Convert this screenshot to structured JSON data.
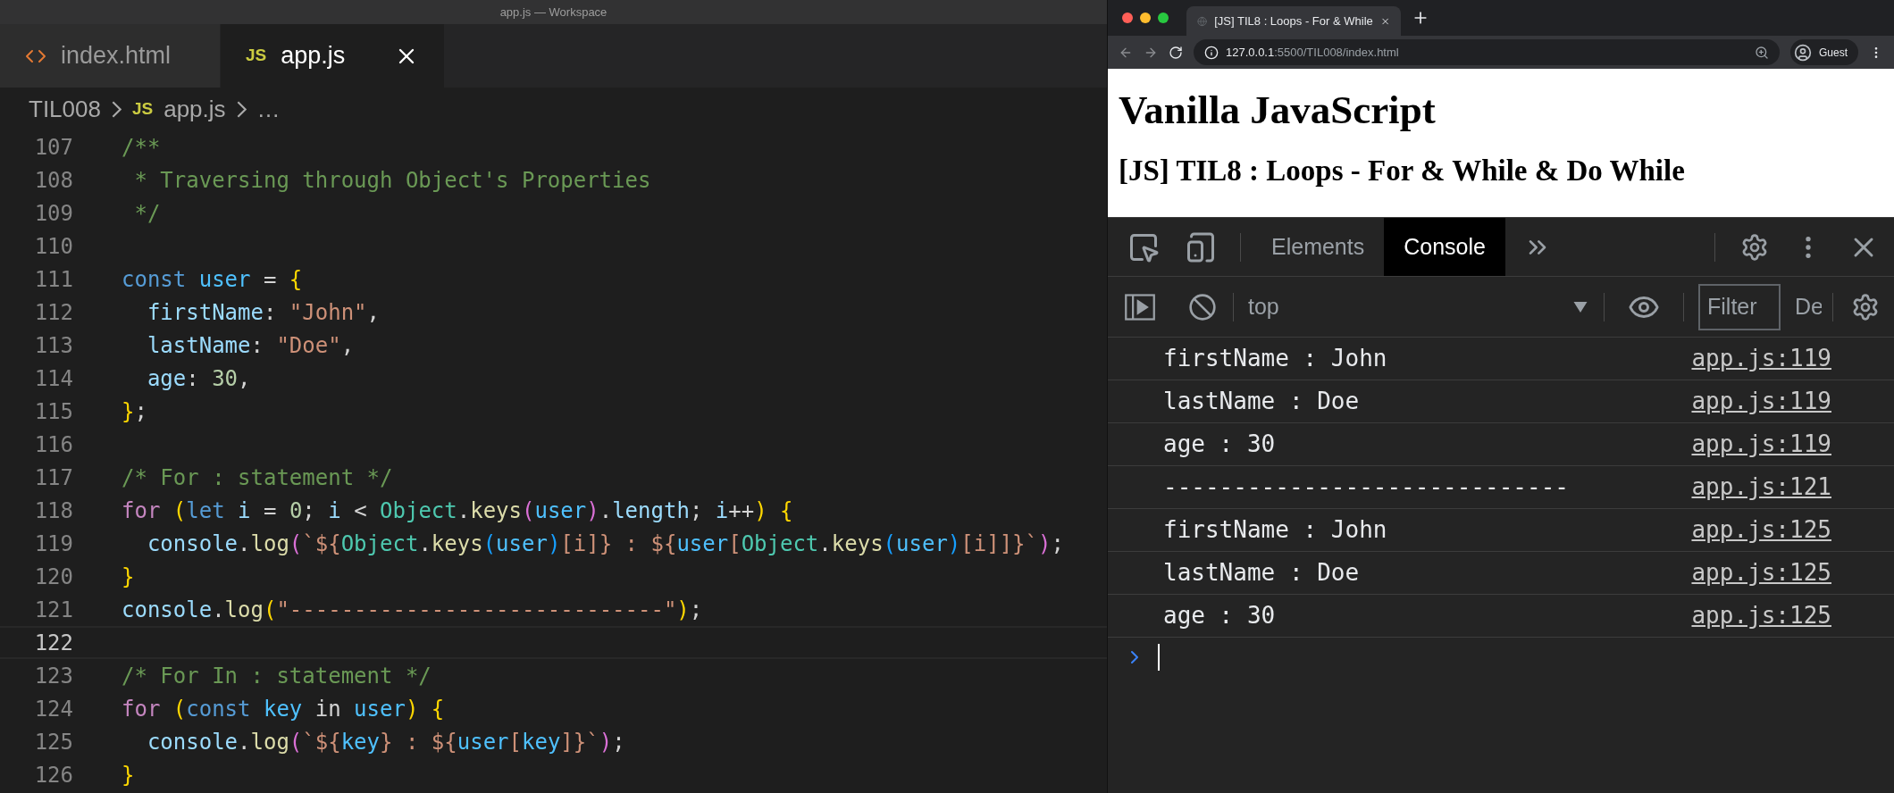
{
  "window": {
    "title": "app.js — Workspace"
  },
  "editor": {
    "tabs": [
      {
        "kind": "html",
        "label": "index.html",
        "selected": false
      },
      {
        "kind": "js",
        "badge": "JS",
        "label": "app.js",
        "selected": true
      }
    ],
    "breadcrumb": [
      {
        "kind": "folder",
        "label": "TIL008"
      },
      {
        "kind": "js",
        "badge": "JS",
        "label": "app.js"
      },
      {
        "kind": "more",
        "label": "…"
      }
    ],
    "lines": [
      {
        "number": "107",
        "current": false,
        "tokens": [
          {
            "kind": "comment",
            "text": "/**"
          }
        ]
      },
      {
        "number": "108",
        "current": false,
        "tokens": [
          {
            "kind": "comment",
            "text": " * Traversing through Object's Properties"
          }
        ]
      },
      {
        "number": "109",
        "current": false,
        "tokens": [
          {
            "kind": "comment",
            "text": " */"
          }
        ]
      },
      {
        "number": "110",
        "current": false
      },
      {
        "number": "111",
        "current": false,
        "tokens": [
          {
            "kind": "storage",
            "text": "const"
          },
          {
            "kind": "constant",
            "text": " user"
          },
          {
            "kind": "plain",
            "text": " = "
          },
          {
            "kind": "bracket1",
            "text": "{"
          }
        ]
      },
      {
        "number": "112",
        "current": false,
        "tokens": [
          {
            "kind": "property",
            "text": "  firstName"
          },
          {
            "kind": "plain",
            "text": ": "
          },
          {
            "kind": "string",
            "text": "\"John\""
          },
          {
            "kind": "plain",
            "text": ","
          }
        ]
      },
      {
        "number": "113",
        "current": false,
        "tokens": [
          {
            "kind": "property",
            "text": "  lastName"
          },
          {
            "kind": "plain",
            "text": ": "
          },
          {
            "kind": "string",
            "text": "\"Doe\""
          },
          {
            "kind": "plain",
            "text": ","
          }
        ]
      },
      {
        "number": "114",
        "current": false,
        "tokens": [
          {
            "kind": "property",
            "text": "  age"
          },
          {
            "kind": "plain",
            "text": ": "
          },
          {
            "kind": "number",
            "text": "30"
          },
          {
            "kind": "plain",
            "text": ","
          }
        ]
      },
      {
        "number": "115",
        "current": false,
        "tokens": [
          {
            "kind": "bracket1",
            "text": "}"
          },
          {
            "kind": "plain",
            "text": ";"
          }
        ]
      },
      {
        "number": "116",
        "current": false
      },
      {
        "number": "117",
        "current": false,
        "tokens": [
          {
            "kind": "comment",
            "text": "/* For : statement */"
          }
        ]
      },
      {
        "number": "118",
        "current": false,
        "tokens": [
          {
            "kind": "control",
            "text": "for"
          },
          {
            "kind": "bracket1",
            "text": " ("
          },
          {
            "kind": "storage",
            "text": "let"
          },
          {
            "kind": "property",
            "text": " i"
          },
          {
            "kind": "plain",
            "text": " = "
          },
          {
            "kind": "number",
            "text": "0"
          },
          {
            "kind": "plain",
            "text": "; "
          },
          {
            "kind": "property",
            "text": "i"
          },
          {
            "kind": "plain",
            "text": " < "
          },
          {
            "kind": "class",
            "text": "Object"
          },
          {
            "kind": "plain",
            "text": "."
          },
          {
            "kind": "function",
            "text": "keys"
          },
          {
            "kind": "bracket2",
            "text": "("
          },
          {
            "kind": "constant",
            "text": "user"
          },
          {
            "kind": "bracket2",
            "text": ")"
          },
          {
            "kind": "plain",
            "text": "."
          },
          {
            "kind": "property",
            "text": "length"
          },
          {
            "kind": "plain",
            "text": "; "
          },
          {
            "kind": "property",
            "text": "i"
          },
          {
            "kind": "plain",
            "text": "++"
          },
          {
            "kind": "bracket1",
            "text": ")"
          },
          {
            "kind": "bracket1",
            "text": " {"
          }
        ]
      },
      {
        "number": "119",
        "current": false,
        "tokens": [
          {
            "kind": "property",
            "text": "  console"
          },
          {
            "kind": "plain",
            "text": "."
          },
          {
            "kind": "function",
            "text": "log"
          },
          {
            "kind": "bracket2",
            "text": "("
          },
          {
            "kind": "string",
            "text": "`${"
          },
          {
            "kind": "class",
            "text": "Object"
          },
          {
            "kind": "plain",
            "text": "."
          },
          {
            "kind": "function",
            "text": "keys"
          },
          {
            "kind": "bracket3",
            "text": "("
          },
          {
            "kind": "constant",
            "text": "user"
          },
          {
            "kind": "bracket3",
            "text": ")"
          },
          {
            "kind": "string",
            "text": "[i]} : ${"
          },
          {
            "kind": "constant",
            "text": "user"
          },
          {
            "kind": "string",
            "text": "["
          },
          {
            "kind": "class",
            "text": "Object"
          },
          {
            "kind": "plain",
            "text": "."
          },
          {
            "kind": "function",
            "text": "keys"
          },
          {
            "kind": "bracket3",
            "text": "("
          },
          {
            "kind": "constant",
            "text": "user"
          },
          {
            "kind": "bracket3",
            "text": ")"
          },
          {
            "kind": "string",
            "text": "[i]]}`"
          },
          {
            "kind": "bracket2",
            "text": ")"
          },
          {
            "kind": "plain",
            "text": ";"
          }
        ]
      },
      {
        "number": "120",
        "current": false,
        "tokens": [
          {
            "kind": "bracket1",
            "text": "}"
          }
        ]
      },
      {
        "number": "121",
        "current": false,
        "tokens": [
          {
            "kind": "property",
            "text": "console"
          },
          {
            "kind": "plain",
            "text": "."
          },
          {
            "kind": "function",
            "text": "log"
          },
          {
            "kind": "bracket1",
            "text": "("
          },
          {
            "kind": "string",
            "text": "\"-----------------------------\""
          },
          {
            "kind": "bracket1",
            "text": ")"
          },
          {
            "kind": "plain",
            "text": ";"
          }
        ]
      },
      {
        "number": "122",
        "current": true
      },
      {
        "number": "123",
        "current": false,
        "tokens": [
          {
            "kind": "comment",
            "text": "/* For In : statement */"
          }
        ]
      },
      {
        "number": "124",
        "current": false,
        "tokens": [
          {
            "kind": "control",
            "text": "for"
          },
          {
            "kind": "bracket1",
            "text": " ("
          },
          {
            "kind": "storage",
            "text": "const"
          },
          {
            "kind": "constant",
            "text": " key"
          },
          {
            "kind": "plain",
            "text": " in "
          },
          {
            "kind": "constant",
            "text": "user"
          },
          {
            "kind": "bracket1",
            "text": ")"
          },
          {
            "kind": "bracket1",
            "text": " {"
          }
        ]
      },
      {
        "number": "125",
        "current": false,
        "tokens": [
          {
            "kind": "property",
            "text": "  console"
          },
          {
            "kind": "plain",
            "text": "."
          },
          {
            "kind": "function",
            "text": "log"
          },
          {
            "kind": "bracket2",
            "text": "("
          },
          {
            "kind": "string",
            "text": "`${"
          },
          {
            "kind": "constant",
            "text": "key"
          },
          {
            "kind": "string",
            "text": "} : ${"
          },
          {
            "kind": "constant",
            "text": "user"
          },
          {
            "kind": "string",
            "text": "["
          },
          {
            "kind": "constant",
            "text": "key"
          },
          {
            "kind": "string",
            "text": "]}`"
          },
          {
            "kind": "bracket2",
            "text": ")"
          },
          {
            "kind": "plain",
            "text": ";"
          }
        ]
      },
      {
        "number": "126",
        "current": false,
        "tokens": [
          {
            "kind": "bracket1",
            "text": "}"
          }
        ]
      }
    ]
  },
  "browser": {
    "tab_title": "[JS] TIL8 : Loops - For & While",
    "address": {
      "host": "127.0.0.1",
      "rest": ":5500/TIL008/index.html"
    },
    "profile": "Guest",
    "page": {
      "heading": "Vanilla JavaScript",
      "subheading": "[JS] TIL8 : Loops - For & While & Do While"
    },
    "devtools": {
      "tabs": [
        {
          "label": "Elements",
          "selected": false
        },
        {
          "label": "Console",
          "selected": true
        }
      ],
      "context": "top",
      "filter_placeholder": "Filter",
      "levels": "De",
      "messages": [
        {
          "text": "firstName : John",
          "source": "app.js:119"
        },
        {
          "text": "lastName : Doe",
          "source": "app.js:119"
        },
        {
          "text": "age : 30",
          "source": "app.js:119"
        },
        {
          "text": "-----------------------------",
          "source": "app.js:121"
        },
        {
          "text": "firstName : John",
          "source": "app.js:125"
        },
        {
          "text": "lastName : Doe",
          "source": "app.js:125"
        },
        {
          "text": "age : 30",
          "source": "app.js:125"
        }
      ]
    }
  }
}
